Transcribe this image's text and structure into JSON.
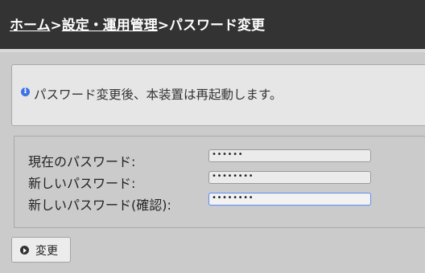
{
  "header": {
    "breadcrumb": {
      "home": "ホーム",
      "sep1": ">",
      "section": "設定・運用管理",
      "sep2": ">",
      "current": "パスワード変更"
    }
  },
  "info": {
    "icon": "info-icon",
    "message": "パスワード変更後、本装置は再起動します。"
  },
  "form": {
    "fields": [
      {
        "label": "現在のパスワード:",
        "value": "••••••"
      },
      {
        "label": "新しいパスワード:",
        "value": "••••••••"
      },
      {
        "label": "新しいパスワード(確認):",
        "value": "••••••••"
      }
    ]
  },
  "actions": {
    "submit_label": "変更",
    "submit_icon": "play-circle-icon"
  }
}
